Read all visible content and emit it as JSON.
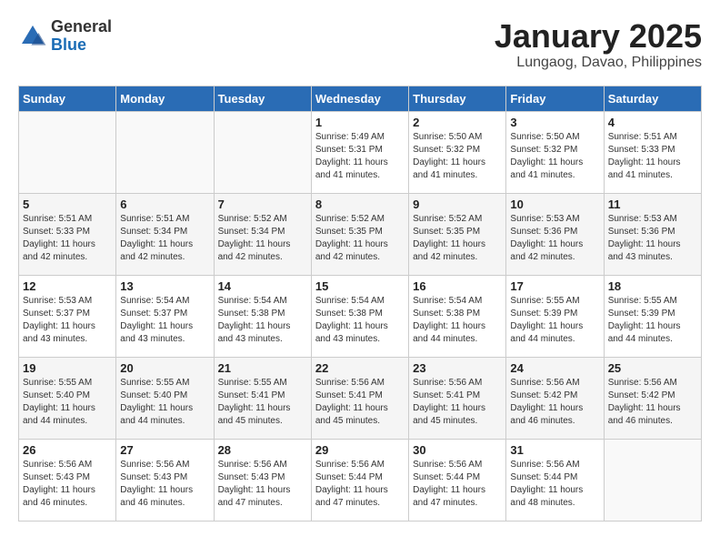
{
  "logo": {
    "general": "General",
    "blue": "Blue"
  },
  "title": "January 2025",
  "location": "Lungaog, Davao, Philippines",
  "days_of_week": [
    "Sunday",
    "Monday",
    "Tuesday",
    "Wednesday",
    "Thursday",
    "Friday",
    "Saturday"
  ],
  "weeks": [
    [
      {
        "day": "",
        "sunrise": "",
        "sunset": "",
        "daylight": ""
      },
      {
        "day": "",
        "sunrise": "",
        "sunset": "",
        "daylight": ""
      },
      {
        "day": "",
        "sunrise": "",
        "sunset": "",
        "daylight": ""
      },
      {
        "day": "1",
        "sunrise": "Sunrise: 5:49 AM",
        "sunset": "Sunset: 5:31 PM",
        "daylight": "Daylight: 11 hours and 41 minutes."
      },
      {
        "day": "2",
        "sunrise": "Sunrise: 5:50 AM",
        "sunset": "Sunset: 5:32 PM",
        "daylight": "Daylight: 11 hours and 41 minutes."
      },
      {
        "day": "3",
        "sunrise": "Sunrise: 5:50 AM",
        "sunset": "Sunset: 5:32 PM",
        "daylight": "Daylight: 11 hours and 41 minutes."
      },
      {
        "day": "4",
        "sunrise": "Sunrise: 5:51 AM",
        "sunset": "Sunset: 5:33 PM",
        "daylight": "Daylight: 11 hours and 41 minutes."
      }
    ],
    [
      {
        "day": "5",
        "sunrise": "Sunrise: 5:51 AM",
        "sunset": "Sunset: 5:33 PM",
        "daylight": "Daylight: 11 hours and 42 minutes."
      },
      {
        "day": "6",
        "sunrise": "Sunrise: 5:51 AM",
        "sunset": "Sunset: 5:34 PM",
        "daylight": "Daylight: 11 hours and 42 minutes."
      },
      {
        "day": "7",
        "sunrise": "Sunrise: 5:52 AM",
        "sunset": "Sunset: 5:34 PM",
        "daylight": "Daylight: 11 hours and 42 minutes."
      },
      {
        "day": "8",
        "sunrise": "Sunrise: 5:52 AM",
        "sunset": "Sunset: 5:35 PM",
        "daylight": "Daylight: 11 hours and 42 minutes."
      },
      {
        "day": "9",
        "sunrise": "Sunrise: 5:52 AM",
        "sunset": "Sunset: 5:35 PM",
        "daylight": "Daylight: 11 hours and 42 minutes."
      },
      {
        "day": "10",
        "sunrise": "Sunrise: 5:53 AM",
        "sunset": "Sunset: 5:36 PM",
        "daylight": "Daylight: 11 hours and 42 minutes."
      },
      {
        "day": "11",
        "sunrise": "Sunrise: 5:53 AM",
        "sunset": "Sunset: 5:36 PM",
        "daylight": "Daylight: 11 hours and 43 minutes."
      }
    ],
    [
      {
        "day": "12",
        "sunrise": "Sunrise: 5:53 AM",
        "sunset": "Sunset: 5:37 PM",
        "daylight": "Daylight: 11 hours and 43 minutes."
      },
      {
        "day": "13",
        "sunrise": "Sunrise: 5:54 AM",
        "sunset": "Sunset: 5:37 PM",
        "daylight": "Daylight: 11 hours and 43 minutes."
      },
      {
        "day": "14",
        "sunrise": "Sunrise: 5:54 AM",
        "sunset": "Sunset: 5:38 PM",
        "daylight": "Daylight: 11 hours and 43 minutes."
      },
      {
        "day": "15",
        "sunrise": "Sunrise: 5:54 AM",
        "sunset": "Sunset: 5:38 PM",
        "daylight": "Daylight: 11 hours and 43 minutes."
      },
      {
        "day": "16",
        "sunrise": "Sunrise: 5:54 AM",
        "sunset": "Sunset: 5:38 PM",
        "daylight": "Daylight: 11 hours and 44 minutes."
      },
      {
        "day": "17",
        "sunrise": "Sunrise: 5:55 AM",
        "sunset": "Sunset: 5:39 PM",
        "daylight": "Daylight: 11 hours and 44 minutes."
      },
      {
        "day": "18",
        "sunrise": "Sunrise: 5:55 AM",
        "sunset": "Sunset: 5:39 PM",
        "daylight": "Daylight: 11 hours and 44 minutes."
      }
    ],
    [
      {
        "day": "19",
        "sunrise": "Sunrise: 5:55 AM",
        "sunset": "Sunset: 5:40 PM",
        "daylight": "Daylight: 11 hours and 44 minutes."
      },
      {
        "day": "20",
        "sunrise": "Sunrise: 5:55 AM",
        "sunset": "Sunset: 5:40 PM",
        "daylight": "Daylight: 11 hours and 44 minutes."
      },
      {
        "day": "21",
        "sunrise": "Sunrise: 5:55 AM",
        "sunset": "Sunset: 5:41 PM",
        "daylight": "Daylight: 11 hours and 45 minutes."
      },
      {
        "day": "22",
        "sunrise": "Sunrise: 5:56 AM",
        "sunset": "Sunset: 5:41 PM",
        "daylight": "Daylight: 11 hours and 45 minutes."
      },
      {
        "day": "23",
        "sunrise": "Sunrise: 5:56 AM",
        "sunset": "Sunset: 5:41 PM",
        "daylight": "Daylight: 11 hours and 45 minutes."
      },
      {
        "day": "24",
        "sunrise": "Sunrise: 5:56 AM",
        "sunset": "Sunset: 5:42 PM",
        "daylight": "Daylight: 11 hours and 46 minutes."
      },
      {
        "day": "25",
        "sunrise": "Sunrise: 5:56 AM",
        "sunset": "Sunset: 5:42 PM",
        "daylight": "Daylight: 11 hours and 46 minutes."
      }
    ],
    [
      {
        "day": "26",
        "sunrise": "Sunrise: 5:56 AM",
        "sunset": "Sunset: 5:43 PM",
        "daylight": "Daylight: 11 hours and 46 minutes."
      },
      {
        "day": "27",
        "sunrise": "Sunrise: 5:56 AM",
        "sunset": "Sunset: 5:43 PM",
        "daylight": "Daylight: 11 hours and 46 minutes."
      },
      {
        "day": "28",
        "sunrise": "Sunrise: 5:56 AM",
        "sunset": "Sunset: 5:43 PM",
        "daylight": "Daylight: 11 hours and 47 minutes."
      },
      {
        "day": "29",
        "sunrise": "Sunrise: 5:56 AM",
        "sunset": "Sunset: 5:44 PM",
        "daylight": "Daylight: 11 hours and 47 minutes."
      },
      {
        "day": "30",
        "sunrise": "Sunrise: 5:56 AM",
        "sunset": "Sunset: 5:44 PM",
        "daylight": "Daylight: 11 hours and 47 minutes."
      },
      {
        "day": "31",
        "sunrise": "Sunrise: 5:56 AM",
        "sunset": "Sunset: 5:44 PM",
        "daylight": "Daylight: 11 hours and 48 minutes."
      },
      {
        "day": "",
        "sunrise": "",
        "sunset": "",
        "daylight": ""
      }
    ]
  ]
}
